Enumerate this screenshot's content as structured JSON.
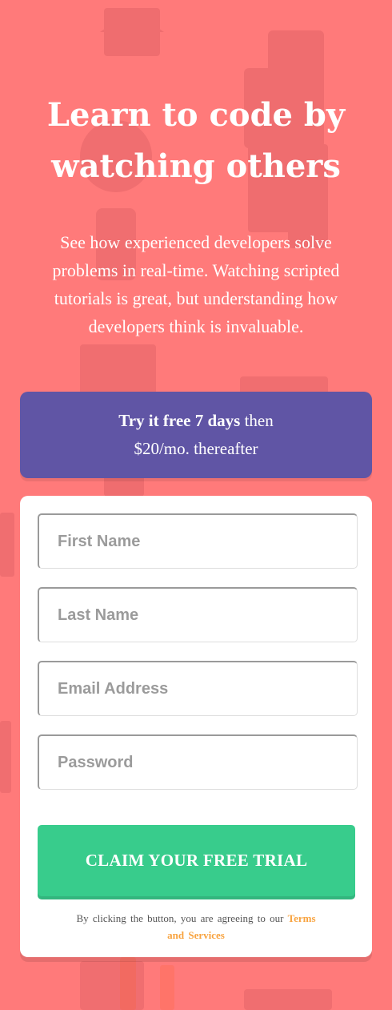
{
  "colors": {
    "background": "#ff7a7a",
    "promo_background": "#6055a5",
    "cta_background": "#38cc8c",
    "link": "#f8a33f"
  },
  "hero": {
    "title_line1": "Learn to code by",
    "title_line2": "watching others",
    "text_line1": "See how experienced developers solve",
    "text_line2": "problems in real-time. Watching scripted",
    "text_line3": "tutorials is great, but understanding how",
    "text_line4": "developers think is invaluable."
  },
  "promo": {
    "bold": "Try it free 7 days",
    "rest1": " then",
    "rest2": "$20/mo. thereafter"
  },
  "form": {
    "first_name_placeholder": "First Name",
    "last_name_placeholder": "Last Name",
    "email_placeholder": "Email Address",
    "password_placeholder": "Password",
    "submit_label": "CLAIM YOUR FREE TRIAL",
    "legal_prefix": "By clicking the button, you are agreeing to our ",
    "legal_link_line1": "Terms",
    "legal_link_line2": "and Services"
  }
}
